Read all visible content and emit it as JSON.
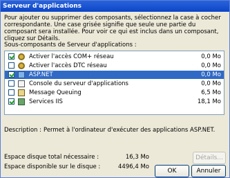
{
  "window": {
    "title": "Serveur d'applications"
  },
  "instructions": "Pour ajouter ou supprimer des composants, sélectionnez la case à cocher correspondante. Une case grisée signifie que seule une partie du composant sera installée. Pour voir ce qui est inclus dans un composant, cliquez sur Détails.",
  "subcomponents_label": "Sous-composants de Serveur d'applications :",
  "components": [
    {
      "name": "Activer l'accès COM+ réseau",
      "size": "0,0 Mo",
      "icon": "gear-icon",
      "checked": true,
      "selected": false
    },
    {
      "name": "Activer l'accès DTC réseau",
      "size": "0,0 Mo",
      "icon": "gear-icon",
      "checked": false,
      "selected": false
    },
    {
      "name": "ASP.NET",
      "size": "0,0 Mo",
      "icon": "network-icon",
      "checked": true,
      "selected": true
    },
    {
      "name": "Console du serveur d'applications",
      "size": "0,0 Mo",
      "icon": "app-icon",
      "checked": false,
      "selected": false
    },
    {
      "name": "Message Queuing",
      "size": "6,5 Mo",
      "icon": "message-icon",
      "checked": false,
      "selected": false
    },
    {
      "name": "Services IIS",
      "size": "18,1 Mo",
      "icon": "iis-icon",
      "checked": true,
      "selected": false
    }
  ],
  "description": {
    "label": "Description :",
    "text": "Permet à l'ordinateur d'exécuter des applications ASP.NET."
  },
  "disk": {
    "required_label": "Espace disque total nécessaire :",
    "required_value": "16,3 Mo",
    "available_label": "Espace disponible sur le disque :",
    "available_value": "4496,4 Mo"
  },
  "buttons": {
    "details": "Détails...",
    "ok": "OK",
    "cancel": "Annuler"
  },
  "colors": {
    "title_bar": "#0b46c9",
    "selection": "#316ac5",
    "window_bg": "#ece9d8"
  }
}
